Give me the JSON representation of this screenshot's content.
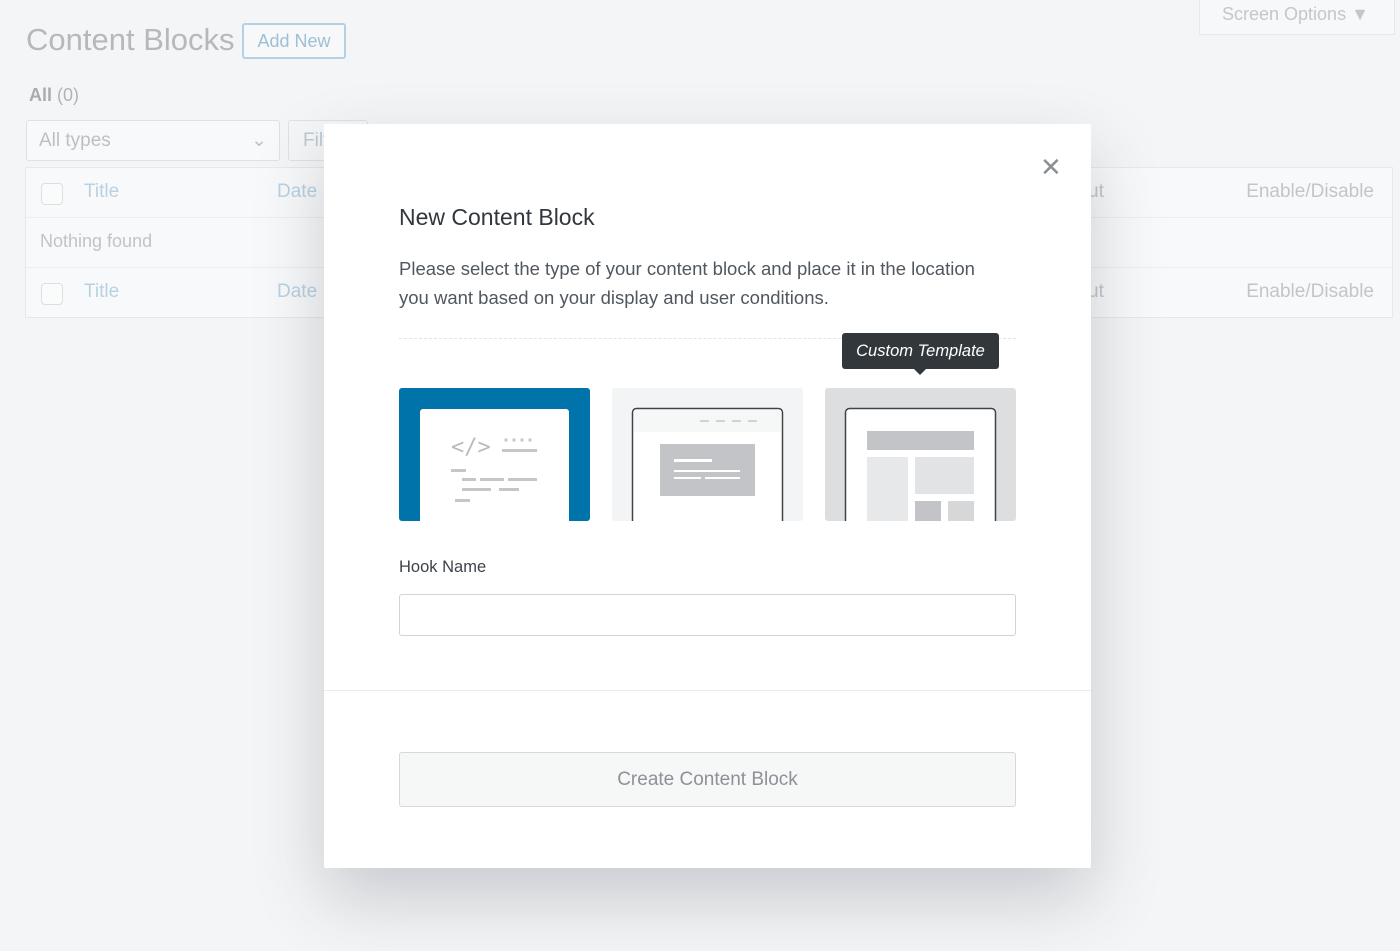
{
  "header": {
    "title": "Content Blocks",
    "add_new": "Add New",
    "screen_options": "Screen Options ▼"
  },
  "filters": {
    "all_label": "All",
    "all_count": "(0)",
    "type_select": "All types",
    "filter_button": "Filter"
  },
  "table": {
    "columns": {
      "title": "Title",
      "date": "Date",
      "layout_partial": "ut",
      "enable": "Enable/Disable"
    },
    "empty": "Nothing found"
  },
  "modal": {
    "title": "New Content Block",
    "description": "Please select the type of your content block and place it in the location you want based on your display and user conditions.",
    "tooltip": "Custom Template",
    "types": [
      {
        "name": "hook",
        "selected": true
      },
      {
        "name": "popup",
        "selected": false
      },
      {
        "name": "custom-template",
        "selected": false,
        "hovered": true
      }
    ],
    "hook_label": "Hook Name",
    "hook_value": "",
    "submit": "Create Content Block"
  },
  "colors": {
    "accent": "#0073aa",
    "tooltip": "#32373c"
  }
}
